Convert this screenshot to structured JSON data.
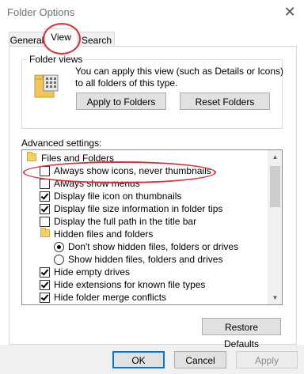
{
  "window": {
    "title": "Folder Options",
    "close_glyph": "✕"
  },
  "tabs": [
    {
      "label": "General",
      "active": false
    },
    {
      "label": "View",
      "active": true
    },
    {
      "label": "Search",
      "active": false
    }
  ],
  "folder_views": {
    "group_label": "Folder views",
    "description": "You can apply this view (such as Details or Icons) to all folders of this type.",
    "apply_button": "Apply to Folders",
    "reset_button": "Reset Folders"
  },
  "advanced": {
    "label": "Advanced settings:",
    "items": [
      {
        "type": "folder",
        "indent": 0,
        "label": "Files and Folders"
      },
      {
        "type": "checkbox",
        "indent": 1,
        "checked": false,
        "label": "Always show icons, never thumbnails"
      },
      {
        "type": "checkbox",
        "indent": 1,
        "checked": false,
        "label": "Always show menus"
      },
      {
        "type": "checkbox",
        "indent": 1,
        "checked": true,
        "label": "Display file icon on thumbnails"
      },
      {
        "type": "checkbox",
        "indent": 1,
        "checked": true,
        "label": "Display file size information in folder tips"
      },
      {
        "type": "checkbox",
        "indent": 1,
        "checked": false,
        "label": "Display the full path in the title bar"
      },
      {
        "type": "folder",
        "indent": 1,
        "label": "Hidden files and folders"
      },
      {
        "type": "radio",
        "indent": 2,
        "selected": true,
        "label": "Don't show hidden files, folders or drives"
      },
      {
        "type": "radio",
        "indent": 2,
        "selected": false,
        "label": "Show hidden files, folders and drives"
      },
      {
        "type": "checkbox",
        "indent": 1,
        "checked": true,
        "label": "Hide empty drives"
      },
      {
        "type": "checkbox",
        "indent": 1,
        "checked": true,
        "label": "Hide extensions for known file types"
      },
      {
        "type": "checkbox",
        "indent": 1,
        "checked": true,
        "label": "Hide folder merge conflicts"
      }
    ],
    "scroll_up_glyph": "▲",
    "scroll_down_glyph": "▼"
  },
  "restore_button": "Restore Defaults",
  "footer": {
    "ok": "OK",
    "cancel": "Cancel",
    "apply": "Apply"
  },
  "colors": {
    "highlight_oval": "#d8303a",
    "accent": "#0078d7"
  }
}
